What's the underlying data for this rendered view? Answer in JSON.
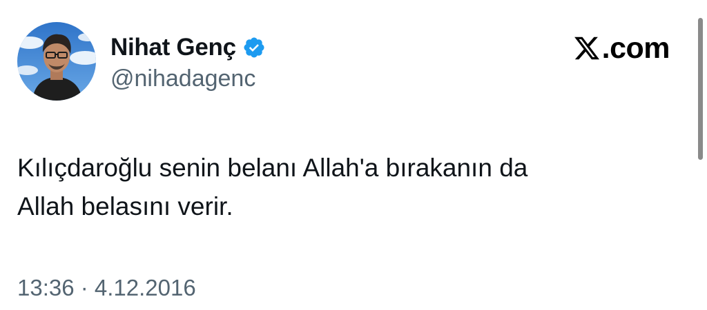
{
  "author": {
    "display_name": "Nihat Genç",
    "handle": "@nihadagenc",
    "verified": true,
    "avatar": "profile-photo-avatar"
  },
  "brand": {
    "logo_icon": "x-logo-icon",
    "suffix": ".com",
    "colors": {
      "logo": "#000000"
    }
  },
  "tweet": {
    "text": "Kılıçdaroğlu senin belanı Allah'a bırakanın da\nAllah belasını verir."
  },
  "meta": {
    "time_date": "13:36 · 4.12.2016"
  },
  "colors": {
    "text": "#0f1419",
    "secondary": "#536471",
    "verified_badge": "#1d9bf0"
  }
}
